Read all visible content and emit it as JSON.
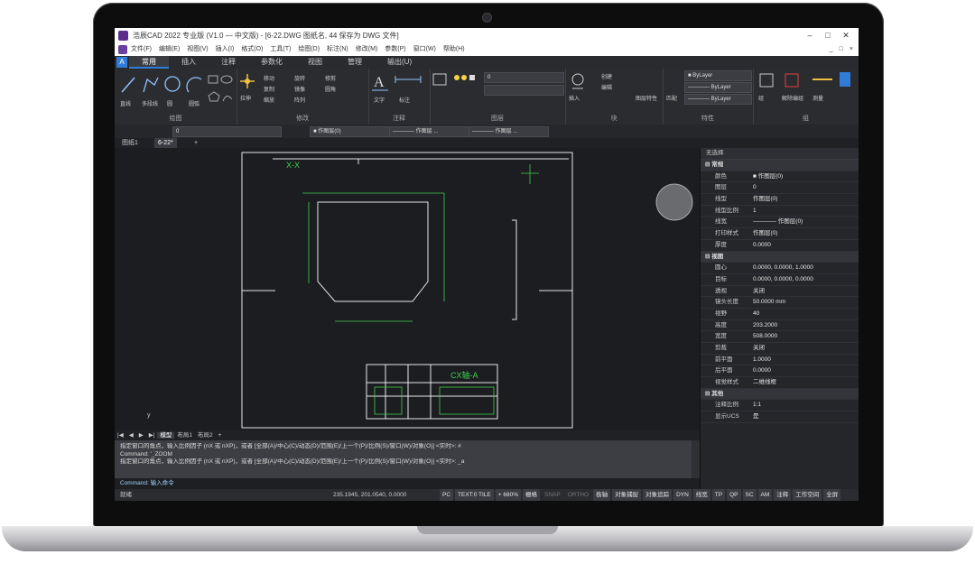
{
  "window": {
    "title": "浩辰CAD 2022 专业版 (V1.0 — 中文版) - [6-22.DWG 图纸名, 44 保存为 DWG 文件]"
  },
  "menu": {
    "items": [
      "文件(F)",
      "编辑(E)",
      "视图(V)",
      "插入(I)",
      "格式(O)",
      "工具(T)",
      "绘图(D)",
      "标注(N)",
      "修改(M)",
      "参数(P)",
      "窗口(W)",
      "帮助(H)"
    ],
    "right": [
      "_",
      "□",
      "×"
    ]
  },
  "tabs": [
    "常用",
    "插入",
    "注释",
    "参数化",
    "视图",
    "管理",
    "输出(U)"
  ],
  "ribbon": {
    "panels": [
      "绘图",
      "修改",
      "注释",
      "图层",
      "块",
      "特性",
      "组"
    ],
    "draw_buttons": [
      "直线",
      "多段线",
      "圆",
      "圆弧"
    ],
    "modify_buttons": [
      "移动",
      "旋转",
      "修剪",
      "复制",
      "镜像",
      "圆角",
      "拉伸",
      "缩放",
      "阵列"
    ],
    "annotation_buttons": [
      "文字",
      "标注"
    ],
    "layer_combo": "0",
    "block_buttons": [
      "插入",
      "创建",
      "编辑"
    ],
    "prop_combo_color": "■ ByLayer",
    "prop_combo_linetype": "———— ByLayer",
    "prop_combo_lineweight": "———— ByLayer",
    "group_buttons": [
      "组",
      "解除编组"
    ],
    "utility_button": "测量",
    "layer_props_button": "图层特性",
    "match_button": "匹配"
  },
  "toolbar2": {
    "layer_combo": "0",
    "color_combo": "■ 作图层(0)",
    "linetype_combo": "———— 作图层 ...",
    "lineweight_combo": "———— 作图层 ..."
  },
  "doctabs": [
    "图纸1",
    "6-22*",
    "+"
  ],
  "drawing": {
    "title_block_label": "CX轴-A",
    "view_label": "X-X"
  },
  "properties": {
    "header": "无选择",
    "rows": [
      {
        "section": true,
        "k": "常规"
      },
      {
        "k": "颜色",
        "v": "■ 作图层(0)"
      },
      {
        "k": "图层",
        "v": "0"
      },
      {
        "k": "线型",
        "v": "作图层(0)"
      },
      {
        "k": "线型比例",
        "v": "1"
      },
      {
        "k": "线宽",
        "v": "———— 作图层(0)"
      },
      {
        "k": "打印样式",
        "v": "作图层(0)"
      },
      {
        "k": "厚度",
        "v": "0.0000"
      },
      {
        "section": true,
        "k": "视图"
      },
      {
        "k": "圆心",
        "v": "0.0000, 0.0000, 1.0000"
      },
      {
        "k": "目标",
        "v": "0.0000, 0.0000, 0.0000"
      },
      {
        "k": "透视",
        "v": "关闭"
      },
      {
        "k": "镜头长度",
        "v": "50.0000 mm"
      },
      {
        "k": "视野",
        "v": "40"
      },
      {
        "k": "高度",
        "v": "203.2000"
      },
      {
        "k": "宽度",
        "v": "508.0000"
      },
      {
        "k": "剪裁",
        "v": "关闭"
      },
      {
        "k": "前平面",
        "v": "1.0000"
      },
      {
        "k": "后平面",
        "v": "0.0000"
      },
      {
        "k": "视觉样式",
        "v": "二维线框"
      },
      {
        "section": true,
        "k": "其他"
      },
      {
        "k": "注释比例",
        "v": "1:1"
      },
      {
        "k": "显示UCS",
        "v": "是"
      }
    ]
  },
  "layout_tabs": [
    "|◀",
    "◀",
    "▶",
    "▶|",
    "模型",
    "布局1",
    "布局2",
    "+"
  ],
  "command": {
    "history": [
      "指定窗口的角点，输入比例因子 (nX 或 nXP)，或者 [全部(A)/中心(C)/动态(D)/范围(E)/上一个(P)/比例(S)/窗口(W)/对象(O)] <实时>: #",
      "Command: '_ZOOM",
      "指定窗口的角点，输入比例因子 (nX 或 nXP)，或者 [全部(A)/中心(C)/动态(D)/范围(E)/上一个(P)/比例(S)/窗口(W)/对象(O)] <实时>: _a"
    ],
    "prompt": "Command: 输入命令"
  },
  "statusbar": {
    "left": "就绪",
    "coords": "235.1945, 201.0540, 0.0000",
    "toggles": [
      "PC",
      "TEXT:0 TILE",
      "+ 680%",
      "栅格",
      "SNAP",
      "ORTHO",
      "极轴",
      "对象捕捉",
      "对象追踪",
      "DYN",
      "线宽",
      "TP",
      "QP",
      "SC",
      "AM",
      "注释",
      "工作空间",
      "全屏"
    ]
  },
  "colors": {
    "background": "#1c1d20",
    "drawing_white": "#e8e8e8",
    "drawing_green": "#3ecf4f",
    "accent": "#2f7dd8"
  }
}
